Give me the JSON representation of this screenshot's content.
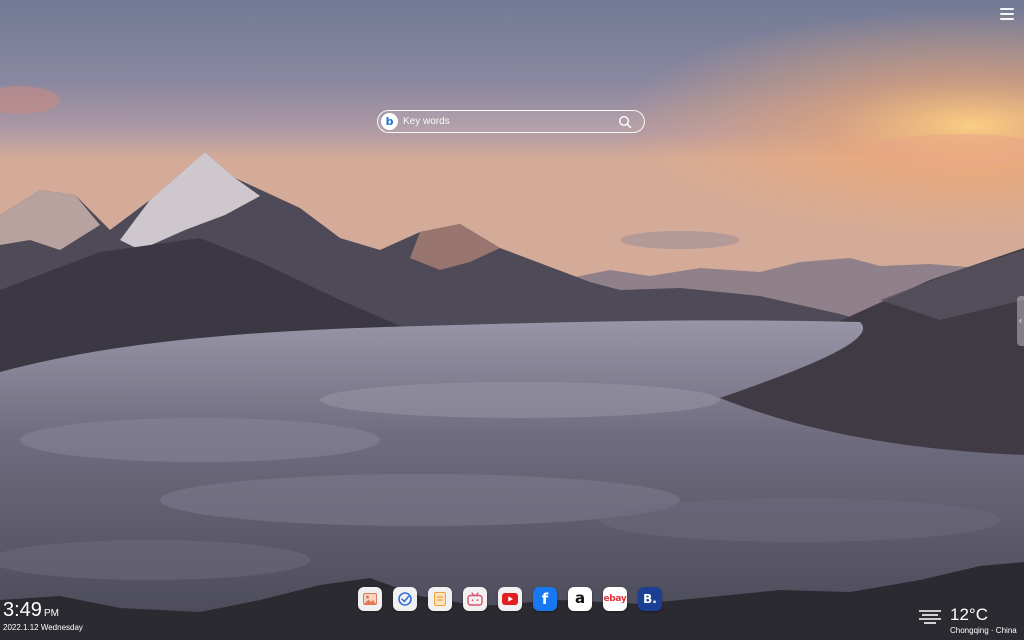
{
  "search": {
    "placeholder": "Key words",
    "engine_icon": "bing-icon",
    "submit_icon": "search-icon"
  },
  "menu": {
    "icon": "hamburger-menu-icon"
  },
  "clock": {
    "time": "3:49",
    "ampm": "PM",
    "date": "2022.1.12 Wednesday"
  },
  "dock": {
    "items": [
      {
        "name": "wallpaper",
        "icon": "image-icon"
      },
      {
        "name": "speed-dial",
        "icon": "checkmark-icon"
      },
      {
        "name": "notes",
        "icon": "note-icon"
      },
      {
        "name": "bilibili",
        "icon": "tv-icon"
      },
      {
        "name": "youtube",
        "icon": "youtube-icon"
      },
      {
        "name": "facebook",
        "icon": "facebook-icon",
        "label": "f"
      },
      {
        "name": "amazon",
        "icon": "amazon-icon",
        "label": "a"
      },
      {
        "name": "ebay",
        "icon": "ebay-icon",
        "label": "ebay"
      },
      {
        "name": "booking",
        "icon": "booking-icon",
        "label": "B."
      }
    ]
  },
  "weather": {
    "temperature": "12°C",
    "location": "Chongqing · China",
    "icon": "fog-icon"
  },
  "colors": {
    "bing": "#1c72d8",
    "youtube": "#e02020",
    "facebook": "#1877f2",
    "ebay_red": "#e53238",
    "ebay_blue": "#0064d2",
    "booking": "#1b3f93",
    "note": "#f3a23b"
  }
}
